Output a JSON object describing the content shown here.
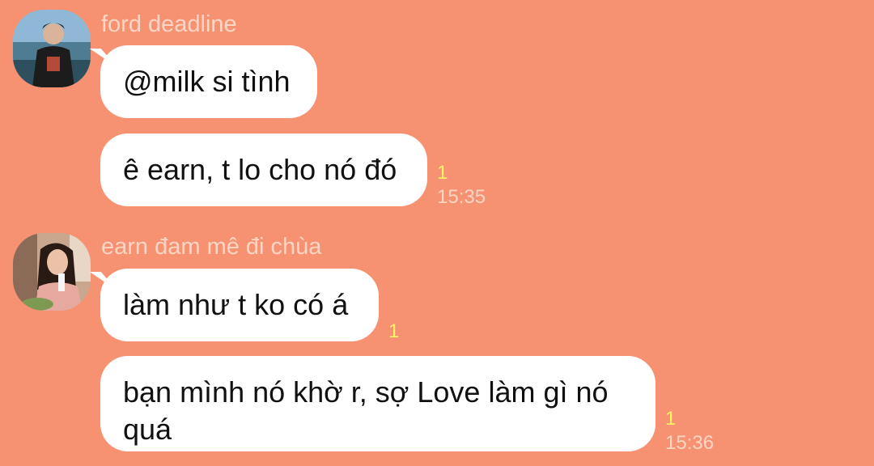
{
  "messages": [
    {
      "sender": "ford deadline",
      "bubbles": [
        {
          "text": "@milk si tình"
        },
        {
          "text": "ê earn, t lo cho nó đó",
          "read": "1",
          "time": "15:35"
        }
      ]
    },
    {
      "sender": "earn đam mê đi chùa",
      "bubbles": [
        {
          "text": "làm như t ko có á",
          "read": "1"
        },
        {
          "text": "bạn mình nó khờ r, sợ Love làm gì nó quá",
          "read": "1",
          "time": "15:36"
        }
      ]
    }
  ],
  "colors": {
    "background": "#F69272",
    "bubble": "#FFFFFF",
    "sender_name": "#FCD6C5",
    "read_count": "#FFF36A",
    "timestamp": "#FCD6C5"
  }
}
